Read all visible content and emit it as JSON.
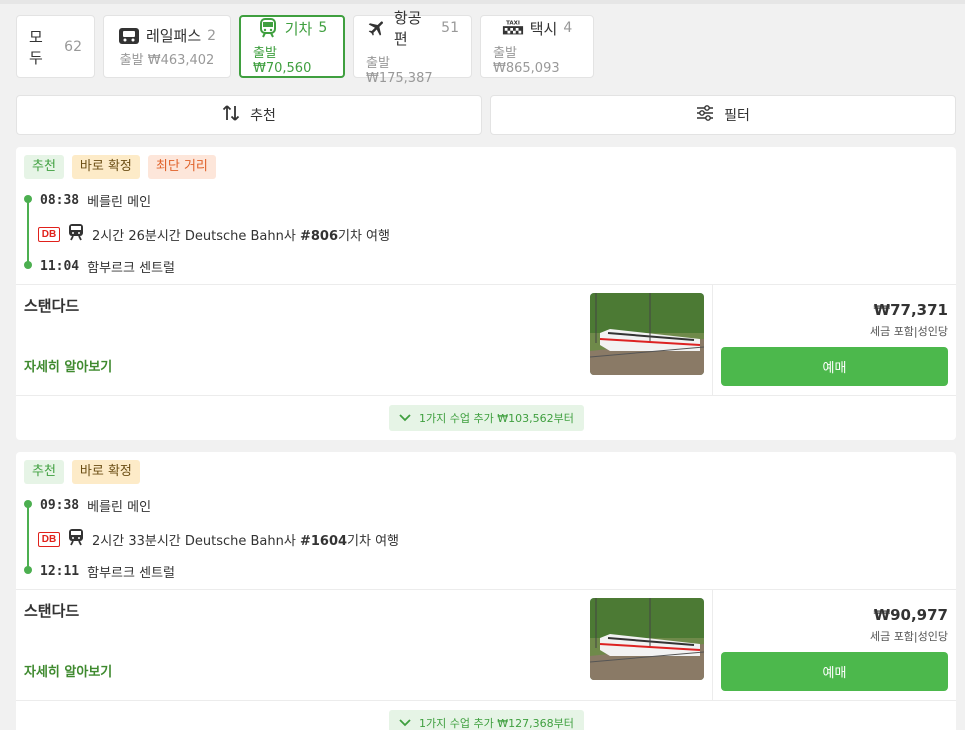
{
  "tabs": [
    {
      "label": "모두",
      "count": "62"
    },
    {
      "label": "레일패스",
      "count": "2",
      "sub": "출발 ₩463,402"
    },
    {
      "label": "기차",
      "count": "5",
      "sub": "출발 ₩70,560"
    },
    {
      "label": "항공편",
      "count": "51",
      "sub": "출발 ₩175,387"
    },
    {
      "label": "택시",
      "count": "4",
      "sub": "출발 ₩865,093"
    }
  ],
  "controls": {
    "sort_label": "추천",
    "filter_label": "필터"
  },
  "cards": [
    {
      "badges": [
        "추천",
        "바로 확정",
        "최단 거리"
      ],
      "depart_time": "08:38",
      "depart_station": "베를린 메인",
      "info_prefix": "2시간 26분시간 Deutsche Bahn사 ",
      "train_no": "#806",
      "info_suffix": "기차 여행",
      "arrive_time": "11:04",
      "arrive_station": "함부르크 센트럴",
      "class_name": "스탠다드",
      "learn_more": "자세히 알아보기",
      "price": "₩77,371",
      "price_note": "세금 포함|성인당",
      "book_label": "예매",
      "more_classes": "1가지 수업 추가 ₩103,562부터"
    },
    {
      "badges": [
        "추천",
        "바로 확정"
      ],
      "depart_time": "09:38",
      "depart_station": "베를린 메인",
      "info_prefix": "2시간 33분시간 Deutsche Bahn사 ",
      "train_no": "#1604",
      "info_suffix": "기차 여행",
      "arrive_time": "12:11",
      "arrive_station": "함부르크 센트럴",
      "class_name": "스탠다드",
      "learn_more": "자세히 알아보기",
      "price": "₩90,977",
      "price_note": "세금 포함|성인당",
      "book_label": "예매",
      "more_classes": "1가지 수업 추가 ₩127,368부터"
    }
  ],
  "icons": {
    "db_logo": "DB",
    "taxi_sign": "TAXI"
  }
}
